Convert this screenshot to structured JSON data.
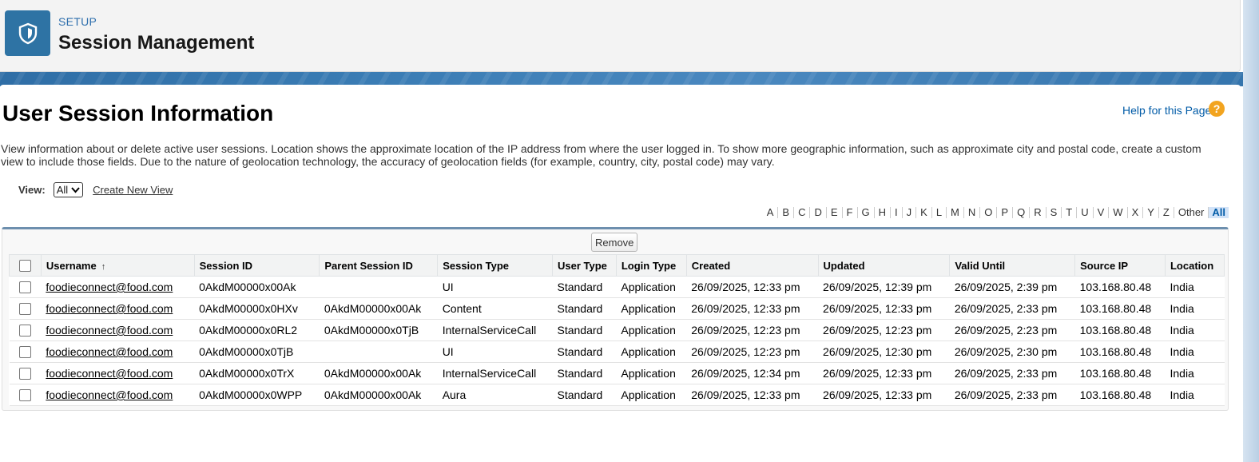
{
  "header": {
    "eyebrow": "SETUP",
    "title": "Session Management",
    "icon": "shield-icon"
  },
  "page": {
    "title": "User Session Information",
    "help_link": "Help for this Page",
    "help_icon": "?",
    "description": "View information about or delete active user sessions. Location shows the approximate location of the IP address from where the user logged in. To show more geographic information, such as approximate city and postal code, create a custom view to include those fields. Due to the nature of geolocation technology, the accuracy of geolocation fields (for example, country, city, postal code) may vary."
  },
  "view": {
    "label": "View:",
    "selected": "All",
    "create_link": "Create New View"
  },
  "alpha_filter": [
    "A",
    "B",
    "C",
    "D",
    "E",
    "F",
    "G",
    "H",
    "I",
    "J",
    "K",
    "L",
    "M",
    "N",
    "O",
    "P",
    "Q",
    "R",
    "S",
    "T",
    "U",
    "V",
    "W",
    "X",
    "Y",
    "Z",
    "Other",
    "All"
  ],
  "alpha_selected": "All",
  "remove_button": "Remove",
  "table": {
    "columns": [
      "Username",
      "Session ID",
      "Parent Session ID",
      "Session Type",
      "User Type",
      "Login Type",
      "Created",
      "Updated",
      "Valid Until",
      "Source IP",
      "Location"
    ],
    "sort_indicator": "↑",
    "rows": [
      [
        "foodieconnect@food.com",
        "0AkdM00000x00Ak",
        "",
        "UI",
        "Standard",
        "Application",
        "26/09/2025, 12:33 pm",
        "26/09/2025, 12:39 pm",
        "26/09/2025, 2:39 pm",
        "103.168.80.48",
        "India"
      ],
      [
        "foodieconnect@food.com",
        "0AkdM00000x0HXv",
        "0AkdM00000x00Ak",
        "Content",
        "Standard",
        "Application",
        "26/09/2025, 12:33 pm",
        "26/09/2025, 12:33 pm",
        "26/09/2025, 2:33 pm",
        "103.168.80.48",
        "India"
      ],
      [
        "foodieconnect@food.com",
        "0AkdM00000x0RL2",
        "0AkdM00000x0TjB",
        "InternalServiceCall",
        "Standard",
        "Application",
        "26/09/2025, 12:23 pm",
        "26/09/2025, 12:23 pm",
        "26/09/2025, 2:23 pm",
        "103.168.80.48",
        "India"
      ],
      [
        "foodieconnect@food.com",
        "0AkdM00000x0TjB",
        "",
        "UI",
        "Standard",
        "Application",
        "26/09/2025, 12:23 pm",
        "26/09/2025, 12:30 pm",
        "26/09/2025, 2:30 pm",
        "103.168.80.48",
        "India"
      ],
      [
        "foodieconnect@food.com",
        "0AkdM00000x0TrX",
        "0AkdM00000x00Ak",
        "InternalServiceCall",
        "Standard",
        "Application",
        "26/09/2025, 12:34 pm",
        "26/09/2025, 12:33 pm",
        "26/09/2025, 2:33 pm",
        "103.168.80.48",
        "India"
      ],
      [
        "foodieconnect@food.com",
        "0AkdM00000x0WPP",
        "0AkdM00000x00Ak",
        "Aura",
        "Standard",
        "Application",
        "26/09/2025, 12:33 pm",
        "26/09/2025, 12:33 pm",
        "26/09/2025, 2:33 pm",
        "103.168.80.48",
        "India"
      ]
    ]
  },
  "colors": {
    "brand": "#2e73a4",
    "link": "#015ba7",
    "help": "#f2a41f"
  }
}
